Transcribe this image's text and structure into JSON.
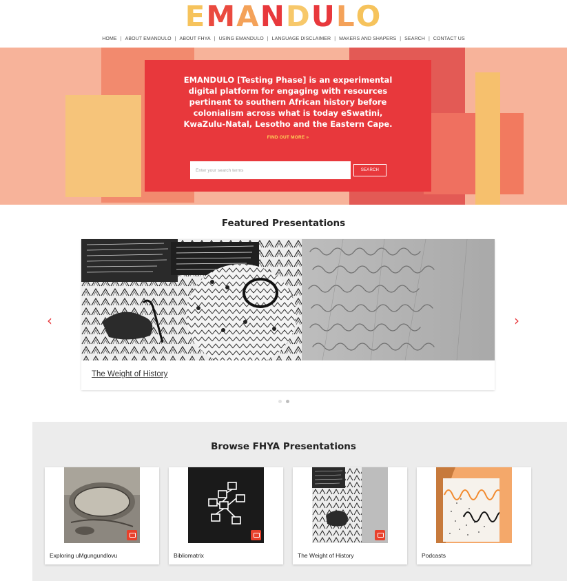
{
  "logo": {
    "letters": [
      "E",
      "M",
      "A",
      "N",
      "D",
      "U",
      "L",
      "O"
    ]
  },
  "nav": [
    "HOME",
    "ABOUT EMANDULO",
    "ABOUT FHYA",
    "USING EMANDULO",
    "LANGUAGE DISCLAIMER",
    "MAKERS AND SHAPERS",
    "SEARCH",
    "CONTACT US"
  ],
  "hero": {
    "text": "EMANDULO [Testing Phase] is an experimental digital platform for engaging with resources pertinent to southern African history before colonialism across what is today eSwatini, KwaZulu-Natal, Lesotho and the Eastern Cape.",
    "link": "FIND OUT MORE »",
    "search_placeholder": "Enter your search terms",
    "search_button": "SEARCH"
  },
  "featured": {
    "title": "Featured Presentations",
    "caption": "The Weight of History",
    "prev": "‹",
    "next": "›"
  },
  "browse": {
    "title": "Browse FHYA Presentations",
    "cards": [
      {
        "label": "Exploring uMgungundlovu"
      },
      {
        "label": "Bibliomatrix"
      },
      {
        "label": "The Weight of History"
      },
      {
        "label": "Podcasts"
      }
    ]
  },
  "colors": {
    "accent_red": "#e8383c",
    "hero_bg": "#f7b39a",
    "link_yellow": "#ffd75a"
  }
}
